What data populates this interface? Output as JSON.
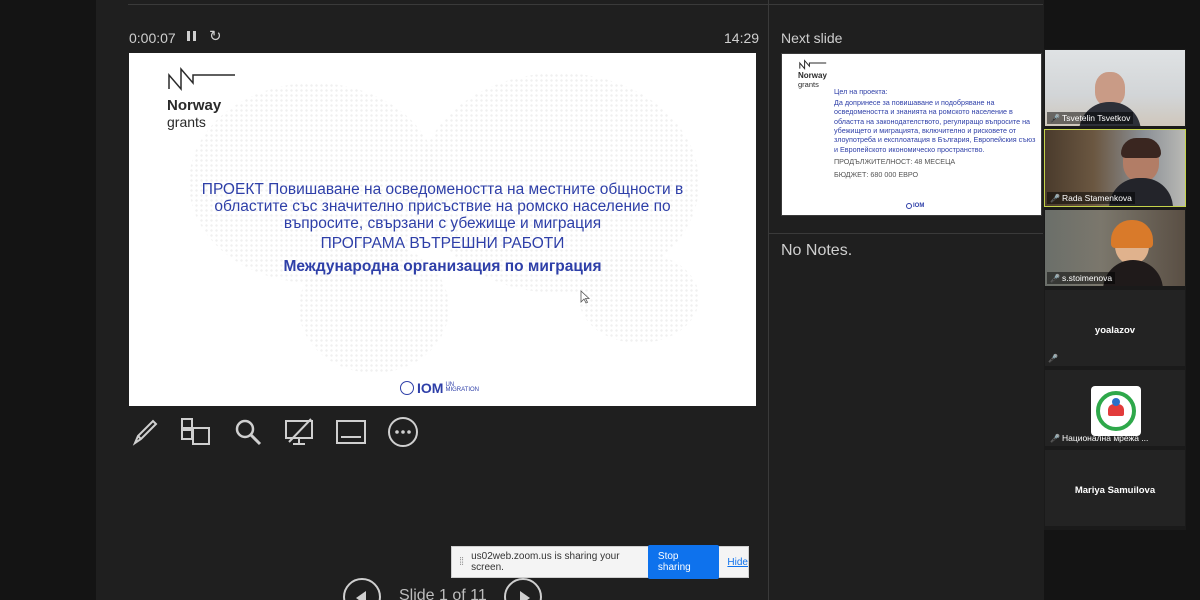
{
  "presenter": {
    "elapsed_time": "0:00:07",
    "clock": "14:29",
    "next_slide_label": "Next slide",
    "notes": "No Notes.",
    "slide_counter": "Slide 1 of 11"
  },
  "current_slide": {
    "logo_line1": "Norway",
    "logo_line2": "grants",
    "title_lines": [
      "ПРОЕКТ Повишаване на осведомеността на местните общности в",
      "областите със значително присъствие на ромско население по",
      "въпросите, свързани с убежище и миграция"
    ],
    "program": "ПРОГРАМА ВЪТРЕШНИ РАБОТИ",
    "organization": "Международна организация по миграция",
    "iom_logo": "IOM",
    "iom_sub1": "UN",
    "iom_sub2": "MIGRATION"
  },
  "next_slide": {
    "logo_line1": "Norway",
    "logo_line2": "grants",
    "goal_label": "Цел на проекта:",
    "goal_lines": [
      "Да допринесе за повишаване и подобряване на",
      "осведомеността и знанията на ромското население в",
      "областта на законодателството, регулиращо въпросите на",
      "убежището и миграцията, включително и рисковете от",
      "злоупотреба и експлоатация в България, Европейския съюз",
      "и Европейското икономическо пространство."
    ],
    "duration": "ПРОДЪЛЖИТЕЛНОСТ: 48 МЕСЕЦА",
    "budget": "БЮДЖЕТ: 680 000 ЕВРО",
    "iom_logo": "IOM"
  },
  "share_bar": {
    "message": "us02web.zoom.us is sharing your screen.",
    "stop_label": "Stop sharing",
    "hide_label": "Hide"
  },
  "participants": [
    {
      "name": "Tsvetelin Tsvetkov",
      "video": true,
      "muted": true
    },
    {
      "name": "Rada Stamenkova",
      "video": true,
      "muted": true
    },
    {
      "name": "s.stoimenova",
      "video": true,
      "muted": true
    },
    {
      "name": "yoalazov",
      "video": false,
      "muted": true
    },
    {
      "name": "Национална мрежа ...",
      "video": false,
      "muted": true
    },
    {
      "name": "Mariya Samuilova",
      "video": false,
      "muted": false
    }
  ],
  "colors": {
    "slide_blue": "#2e3fa8",
    "zoom_blue": "#0e72ed",
    "mic_off_red": "#e0453c",
    "logo_green": "#2ea84a"
  }
}
